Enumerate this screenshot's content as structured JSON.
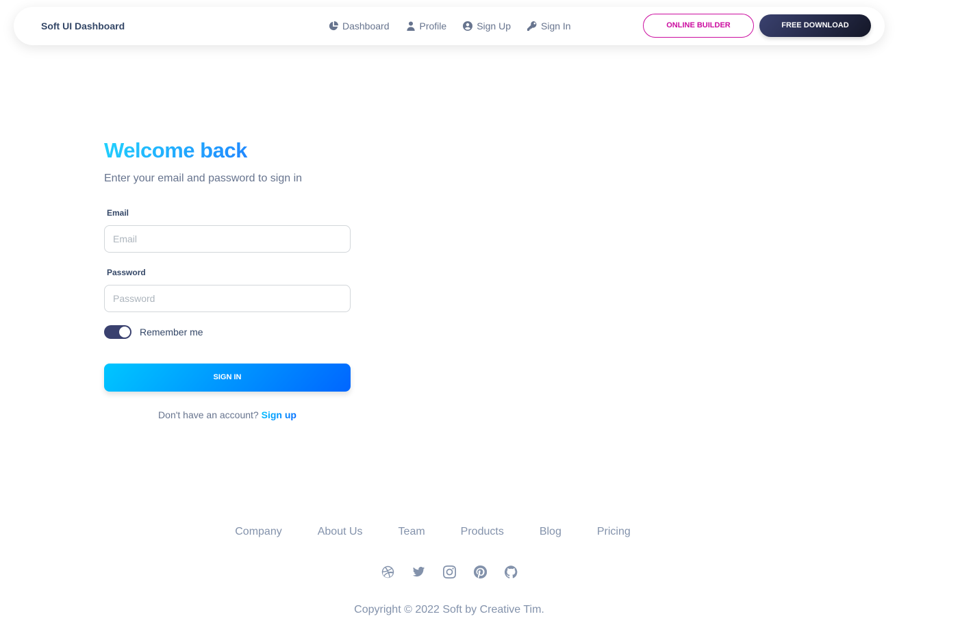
{
  "navbar": {
    "brand": "Soft UI Dashboard",
    "links": [
      {
        "label": "Dashboard",
        "icon": "chart-pie-icon"
      },
      {
        "label": "Profile",
        "icon": "user-icon"
      },
      {
        "label": "Sign Up",
        "icon": "user-circle-icon"
      },
      {
        "label": "Sign In",
        "icon": "key-icon"
      }
    ],
    "online_builder": "ONLINE BUILDER",
    "free_download": "FREE DOWNLOAD"
  },
  "login": {
    "title": "Welcome back",
    "subtitle": "Enter your email and password to sign in",
    "email_label": "Email",
    "email_placeholder": "Email",
    "email_value": "",
    "password_label": "Password",
    "password_placeholder": "Password",
    "password_value": "",
    "remember_label": "Remember me",
    "remember_checked": true,
    "signin_label": "SIGN IN",
    "no_account_text": "Don't have an account?",
    "signup_link": "Sign up"
  },
  "footer": {
    "links": [
      "Company",
      "About Us",
      "Team",
      "Products",
      "Blog",
      "Pricing"
    ],
    "socials": [
      "dribbble-icon",
      "twitter-icon",
      "instagram-icon",
      "pinterest-icon",
      "github-icon"
    ],
    "copyright": "Copyright © 2022 Soft by Creative Tim."
  },
  "colors": {
    "primary": "#cb0c9f",
    "dark": "#344767",
    "info_start": "#0066ff",
    "info_end": "#00c6ff",
    "muted": "#8392ab"
  }
}
